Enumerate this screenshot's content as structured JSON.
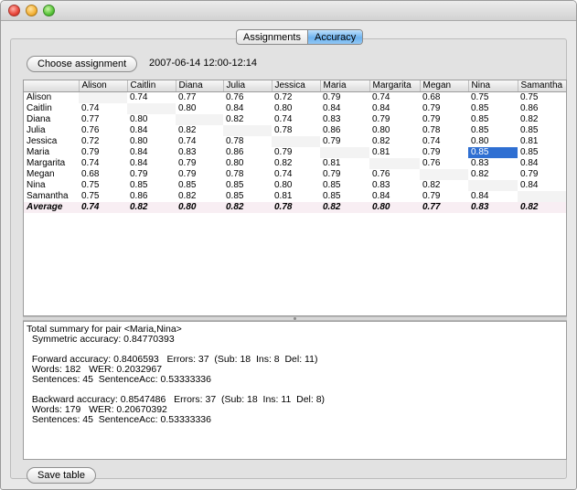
{
  "tabs": [
    {
      "label": "Assignments",
      "active": false
    },
    {
      "label": "Accuracy",
      "active": true
    }
  ],
  "toolbar": {
    "choose_label": "Choose assignment",
    "datetime": "2007-06-14 12:00-12:14"
  },
  "table": {
    "headers": [
      "",
      "Alison",
      "Caitlin",
      "Diana",
      "Julia",
      "Jessica",
      "Maria",
      "Margarita",
      "Megan",
      "Nina",
      "Samantha"
    ],
    "rows": [
      [
        "Alison",
        "",
        "0.74",
        "0.77",
        "0.76",
        "0.72",
        "0.79",
        "0.74",
        "0.68",
        "0.75",
        "0.75"
      ],
      [
        "Caitlin",
        "0.74",
        "",
        "0.80",
        "0.84",
        "0.80",
        "0.84",
        "0.84",
        "0.79",
        "0.85",
        "0.86"
      ],
      [
        "Diana",
        "0.77",
        "0.80",
        "",
        "0.82",
        "0.74",
        "0.83",
        "0.79",
        "0.79",
        "0.85",
        "0.82"
      ],
      [
        "Julia",
        "0.76",
        "0.84",
        "0.82",
        "",
        "0.78",
        "0.86",
        "0.80",
        "0.78",
        "0.85",
        "0.85"
      ],
      [
        "Jessica",
        "0.72",
        "0.80",
        "0.74",
        "0.78",
        "",
        "0.79",
        "0.82",
        "0.74",
        "0.80",
        "0.81"
      ],
      [
        "Maria",
        "0.79",
        "0.84",
        "0.83",
        "0.86",
        "0.79",
        "",
        "0.81",
        "0.79",
        "0.85",
        "0.85"
      ],
      [
        "Margarita",
        "0.74",
        "0.84",
        "0.79",
        "0.80",
        "0.82",
        "0.81",
        "",
        "0.76",
        "0.83",
        "0.84"
      ],
      [
        "Megan",
        "0.68",
        "0.79",
        "0.79",
        "0.78",
        "0.74",
        "0.79",
        "0.76",
        "",
        "0.82",
        "0.79"
      ],
      [
        "Nina",
        "0.75",
        "0.85",
        "0.85",
        "0.85",
        "0.80",
        "0.85",
        "0.83",
        "0.82",
        "",
        "0.84"
      ],
      [
        "Samantha",
        "0.75",
        "0.86",
        "0.82",
        "0.85",
        "0.81",
        "0.85",
        "0.84",
        "0.79",
        "0.84",
        ""
      ]
    ],
    "average": [
      "Average",
      "0.74",
      "0.82",
      "0.80",
      "0.82",
      "0.78",
      "0.82",
      "0.80",
      "0.77",
      "0.83",
      "0.82"
    ],
    "selected": {
      "row": 5,
      "col": 9
    }
  },
  "summary": {
    "lines": [
      "Total summary for pair <Maria,Nina>",
      "  Symmetric accuracy: 0.84770393",
      "",
      "  Forward accuracy: 0.8406593   Errors: 37  (Sub: 18  Ins: 8  Del: 11)",
      "  Words: 182   WER: 0.2032967",
      "  Sentences: 45  SentenceAcc: 0.53333336",
      "",
      "  Backward accuracy: 0.8547486   Errors: 37  (Sub: 18  Ins: 11  Del: 8)",
      "  Words: 179   WER: 0.20670392",
      "  Sentences: 45  SentenceAcc: 0.53333336"
    ]
  },
  "footer": {
    "save_label": "Save table"
  }
}
